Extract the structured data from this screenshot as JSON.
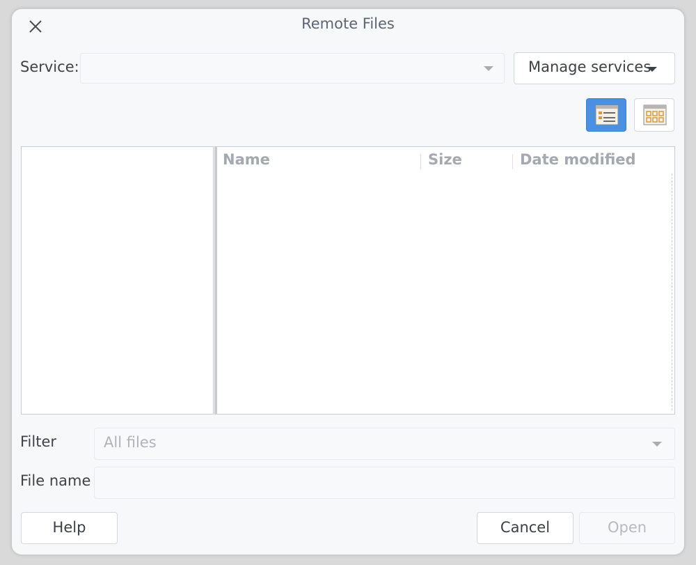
{
  "window": {
    "title": "Remote Files"
  },
  "service": {
    "label": "Service:",
    "value": ""
  },
  "toolbar": {
    "manage_services_label": "Manage services",
    "view_modes": [
      "details-view-icon",
      "icon-view-icon"
    ],
    "active_view": "details"
  },
  "file_list": {
    "columns": [
      "Name",
      "Size",
      "Date modified"
    ],
    "rows": []
  },
  "filter": {
    "label": "Filter",
    "value": "All files"
  },
  "file_name": {
    "label": "File name",
    "value": ""
  },
  "buttons": {
    "help": "Help",
    "cancel": "Cancel",
    "open": "Open"
  },
  "colors": {
    "accent": "#4a90e2",
    "dialog_background": "#f7f8fa"
  }
}
